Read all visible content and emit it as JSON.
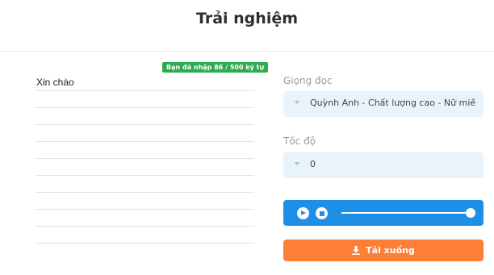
{
  "header": {
    "title": "Trải nghiệm"
  },
  "editor": {
    "char_count_badge": "Bạn đã nhập 86 / 500 ký tự",
    "text": "Xin chào"
  },
  "voice": {
    "label": "Giọng đọc",
    "selected": "Quỳnh Anh - Chất lượng cao - Nữ miề"
  },
  "speed": {
    "label": "Tốc độ",
    "selected": "0"
  },
  "player": {
    "progress": 1.0,
    "color": "#1e8fe6"
  },
  "download": {
    "label": "Tải xuống",
    "icon": "download-icon",
    "color": "#fd7e36"
  }
}
